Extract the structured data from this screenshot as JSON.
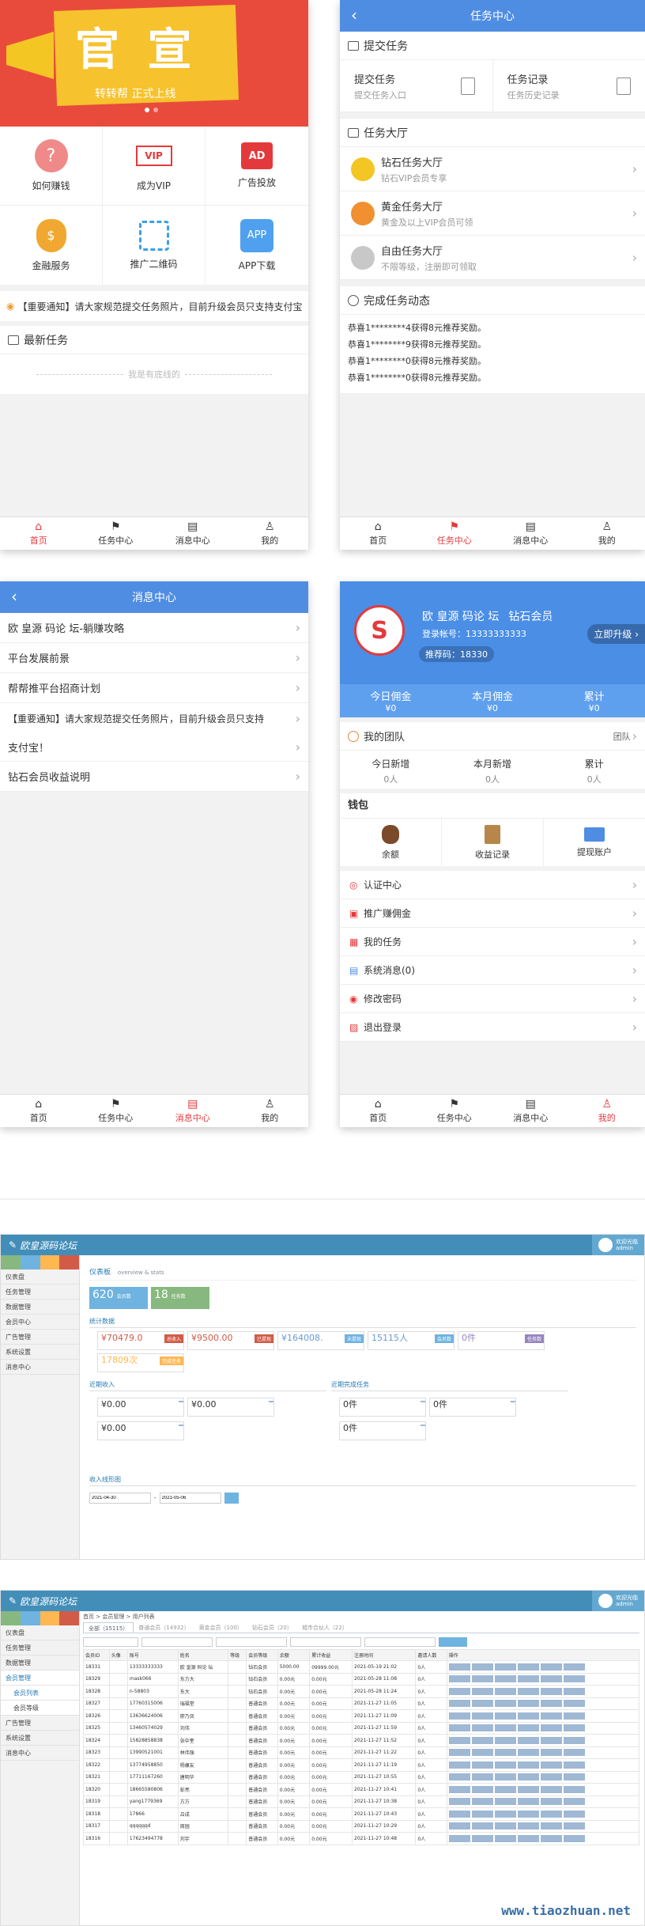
{
  "home": {
    "banner": {
      "big": "官 宣",
      "sub": "转转帮   正式上线"
    },
    "grid": [
      {
        "label": "如何赚钱",
        "icon": "question-icon",
        "color": "#f08080"
      },
      {
        "label": "成为VIP",
        "icon": "vip-crown-icon",
        "color": "#e4393c",
        "badge": "VIP"
      },
      {
        "label": "广告投放",
        "icon": "ad-icon",
        "color": "#e4393c",
        "badge": "AD"
      },
      {
        "label": "金融服务",
        "icon": "money-bag-icon",
        "color": "#f0a830"
      },
      {
        "label": "推广二维码",
        "icon": "qrcode-icon",
        "color": "#3aa0e8"
      },
      {
        "label": "APP下载",
        "icon": "app-icon",
        "color": "#4fa0ef",
        "badge": "APP"
      }
    ],
    "notice": "【重要通知】请大家规范提交任务照片，目前升级会员只支持支付宝",
    "latest_title": "最新任务",
    "empty_text": "我是有底线的"
  },
  "task": {
    "title": "任务中心",
    "submit_section": "提交任务",
    "submit": {
      "label": "提交任务",
      "desc": "提交任务入口"
    },
    "records": {
      "label": "任务记录",
      "desc": "任务历史记录"
    },
    "hall_section": "任务大厅",
    "halls": [
      {
        "name": "钻石任务大厅",
        "desc": "钻石VIP会员专享",
        "color": "#f3c623"
      },
      {
        "name": "黄金任务大厅",
        "desc": "黄金及以上VIP会员可领",
        "color": "#f09030"
      },
      {
        "name": "自由任务大厅",
        "desc": "不限等级，注册即可领取",
        "color": "#c8c8c8"
      }
    ],
    "dynamics_section": "完成任务动态",
    "dynamics": [
      "恭喜1********4获得8元推荐奖励。",
      "恭喜1********9获得8元推荐奖励。",
      "恭喜1********0获得8元推荐奖励。",
      "恭喜1********0获得8元推荐奖励。"
    ]
  },
  "tabs": [
    "首页",
    "任务中心",
    "消息中心",
    "我的"
  ],
  "msg": {
    "title": "消息中心",
    "items": [
      "欧 皇源 码论 坛-躺赚攻略",
      "平台发展前景",
      "帮帮推平台招商计划",
      "【重要通知】请大家规范提交任务照片，目前升级会员只支持",
      "支付宝！",
      "钻石会员收益说明"
    ]
  },
  "me": {
    "name": "欧 皇源 码论 坛",
    "level": "钻石会员",
    "account": "登录帐号：13333333333",
    "invite": "推荐码：18330",
    "upgrade": "立即升级",
    "stats": [
      {
        "label": "今日佣金",
        "value": "¥0"
      },
      {
        "label": "本月佣金",
        "value": "¥0"
      },
      {
        "label": "累计",
        "value": "¥0"
      }
    ],
    "team_title": "我的团队",
    "team_link": "团队",
    "team_stats": [
      {
        "label": "今日新增",
        "value": "0人"
      },
      {
        "label": "本月新增",
        "value": "0人"
      },
      {
        "label": "累计",
        "value": "0人"
      }
    ],
    "wallet_title": "钱包",
    "wallet": [
      {
        "label": "余额",
        "icon": "money-bag-icon"
      },
      {
        "label": "收益记录",
        "icon": "ledger-icon"
      },
      {
        "label": "提现账户",
        "icon": "card-icon"
      }
    ],
    "menu": [
      {
        "label": "认证中心",
        "icon": "shield-icon"
      },
      {
        "label": "推广赚佣金",
        "icon": "share-icon"
      },
      {
        "label": "我的任务",
        "icon": "task-icon"
      },
      {
        "label": "系统消息(0)",
        "icon": "message-icon"
      },
      {
        "label": "修改密码",
        "icon": "lock-icon"
      },
      {
        "label": "退出登录",
        "icon": "logout-icon"
      }
    ]
  },
  "admin1": {
    "brand": "欧皇源码论坛",
    "user": "欢迎光临\nadmin",
    "side": [
      "仪表盘",
      "任务管理",
      "数据管理",
      "会员中心",
      "广告管理",
      "系统设置",
      "消息中心"
    ],
    "crumb": "仪表板",
    "crumb_sub": "overview & stats",
    "box1": {
      "num": "620",
      "label": "会员数"
    },
    "box2": {
      "num": "18",
      "label": "任务数"
    },
    "stats_title": "统计数据",
    "stats": [
      {
        "value": "¥70479.0",
        "tag": "总收入",
        "color": "#d15b47"
      },
      {
        "value": "¥9500.00",
        "tag": "已提现",
        "color": "#d15b47"
      },
      {
        "value": "¥164008.",
        "tag": "未提现",
        "color": "#6fb3e0"
      },
      {
        "value": "15115人",
        "tag": "会员数",
        "color": "#6fb3e0"
      },
      {
        "value": "0件",
        "tag": "任务数",
        "color": "#9585bf"
      },
      {
        "value": "17809次",
        "tag": "完成任务",
        "color": "#ffb752"
      }
    ],
    "income_title": "近期收入",
    "income": [
      "¥0.00",
      "¥0.00",
      "¥0.00"
    ],
    "task_title": "近期完成任务",
    "tasks": [
      "0件",
      "0件",
      "0件"
    ],
    "chart_title": "收入线形图",
    "date_from": "2021-04-30",
    "date_to": "2021-05-06"
  },
  "admin2": {
    "brand": "欧皇源码论坛",
    "user": "欢迎光临\nadmin",
    "side": [
      "仪表盘",
      "任务管理",
      "数据管理",
      "会员管理",
      "会员列表",
      "会员等级",
      "广告管理",
      "系统设置",
      "消息中心"
    ],
    "crumb": "首页 > 会员管理 > 用户列表",
    "tabs": [
      "全部（15115）",
      "普通会员（14932）",
      "黄金会员（100）",
      "钻石会员（20）",
      "城市合伙人（22）"
    ],
    "headers": [
      "会员ID",
      "头像",
      "账号",
      "姓名",
      "等级",
      "会员等级",
      "余额",
      "累计收益",
      "注册时间",
      "邀请人数",
      "操作"
    ],
    "rows": [
      [
        "18331",
        "",
        "13333333333",
        "欧 皇源 码论 坛",
        "",
        "钻石会员",
        "5000.00",
        "09999.00元",
        "2021-05-19 21:02",
        "0人"
      ],
      [
        "18329",
        "",
        "mask066",
        "东方大",
        "",
        "钻石会员",
        "0.00元",
        "0.00元",
        "2021-05-28 11:08",
        "0人"
      ],
      [
        "18328",
        "",
        "n-58803",
        "东大",
        "",
        "钻石会员",
        "0.00元",
        "0.00元",
        "2021-05-28 11:24",
        "0人"
      ],
      [
        "18327",
        "",
        "17760315006",
        "瑞福堂",
        "",
        "普通会员",
        "0.00元",
        "0.00元",
        "2021-11-27 11:05",
        "0人"
      ],
      [
        "18326",
        "",
        "13636624006",
        "廖乃凤",
        "",
        "普通会员",
        "0.00元",
        "0.00元",
        "2021-11-27 11:09",
        "0人"
      ],
      [
        "18325",
        "",
        "13460574029",
        "刘伟",
        "",
        "普通会员",
        "0.00元",
        "0.00元",
        "2021-11-27 11:59",
        "0人"
      ],
      [
        "18324",
        "",
        "15828858838",
        "张中奎",
        "",
        "普通会员",
        "0.00元",
        "0.00元",
        "2021-11-27 11:52",
        "0人"
      ],
      [
        "18323",
        "",
        "13990521001",
        "林伟强",
        "",
        "普通会员",
        "0.00元",
        "0.00元",
        "2021-11-27 11:22",
        "0人"
      ],
      [
        "18322",
        "",
        "13774958850",
        "杨康友",
        "",
        "普通会员",
        "0.00元",
        "0.00元",
        "2021-11-27 11:19",
        "0人"
      ],
      [
        "18321",
        "",
        "17711167260",
        "唐明华",
        "",
        "普通会员",
        "0.00元",
        "0.00元",
        "2021-11-27 10:55",
        "0人"
      ],
      [
        "18320",
        "",
        "18665580806",
        "彭亮",
        "",
        "普通会员",
        "0.00元",
        "0.00元",
        "2021-11-27 10:41",
        "0人"
      ],
      [
        "18319",
        "",
        "yang1779369",
        "方方",
        "",
        "普通会员",
        "0.00元",
        "0.00元",
        "2021-11-27 10:38",
        "0人"
      ],
      [
        "18318",
        "",
        "17866",
        "吕成",
        "",
        "普通会员",
        "0.00元",
        "0.00元",
        "2021-11-27 10:43",
        "0人"
      ],
      [
        "18317",
        "",
        "qqqqqqd",
        "周园",
        "",
        "普通会员",
        "0.00元",
        "0.00元",
        "2021-11-27 10:29",
        "0人"
      ],
      [
        "18316",
        "",
        "17623494778",
        "刘宇",
        "",
        "普通会员",
        "0.00元",
        "0.00元",
        "2021-11-27 10:48",
        "0人"
      ]
    ]
  },
  "watermark": "www.tiaozhuan.net"
}
